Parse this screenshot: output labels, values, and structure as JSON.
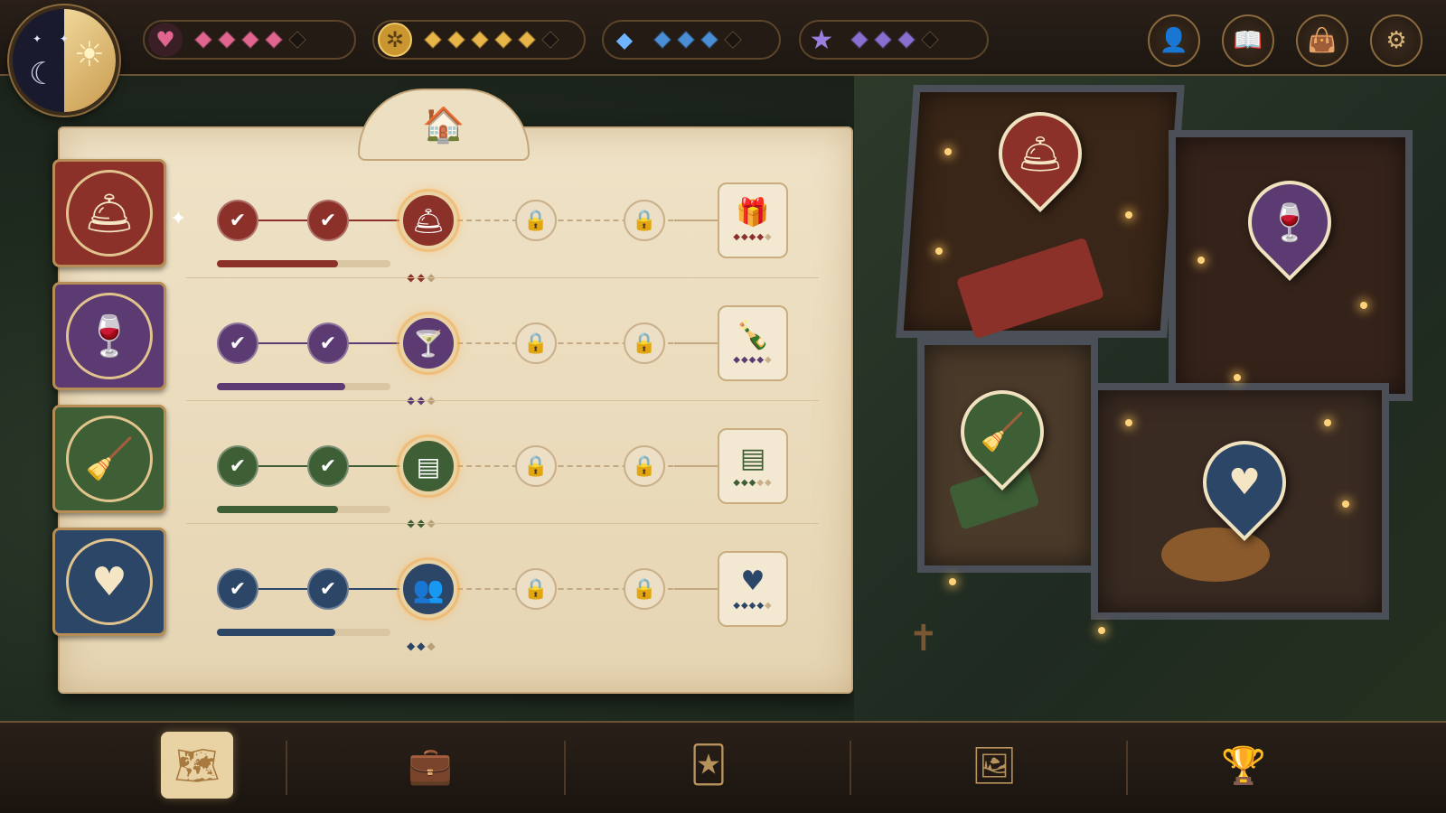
{
  "colors": {
    "hospitality": "#8c3129",
    "bar": "#5c3a72",
    "cleaning": "#3e5f35",
    "care": "#2c4668",
    "heart_pip": "#e0668f",
    "coin_pip": "#e7b548",
    "gem_pip": "#4a8fd6",
    "star_pip": "#8a6fd0"
  },
  "top_bar": {
    "day_night_icon": "sun-moon-icon",
    "stats": [
      {
        "name": "heart",
        "icon": "heart-icon",
        "filled": 4,
        "total": 5
      },
      {
        "name": "coin",
        "icon": "coin-icon",
        "filled": 5,
        "total": 6
      },
      {
        "name": "gem",
        "icon": "gem-icon",
        "filled": 3,
        "total": 4
      },
      {
        "name": "star",
        "icon": "star-icon",
        "filled": 3,
        "total": 4
      }
    ],
    "buttons": [
      "profile-icon",
      "journal-icon",
      "bag-icon",
      "gear-icon"
    ]
  },
  "panel": {
    "header_icon": "manor-icon",
    "tracks": [
      {
        "id": "hospitality",
        "icon": "service-bell-icon",
        "current_icon": "service-bell-icon",
        "completed": 2,
        "locked": 2,
        "reward_icon": "gift-icon",
        "progress": 0.7,
        "gems_filled": 2,
        "gems_total": 3,
        "reward_pips_filled": 4,
        "reward_pips_total": 5
      },
      {
        "id": "bar",
        "icon": "wine-icon",
        "current_icon": "cocktail-icon",
        "completed": 2,
        "locked": 2,
        "reward_icon": "bottle-icon",
        "progress": 0.74,
        "gems_filled": 2,
        "gems_total": 3,
        "reward_pips_filled": 4,
        "reward_pips_total": 5
      },
      {
        "id": "cleaning",
        "icon": "broom-icon",
        "current_icon": "towels-icon",
        "completed": 2,
        "locked": 2,
        "reward_icon": "towels-icon",
        "progress": 0.7,
        "gems_filled": 2,
        "gems_total": 3,
        "reward_pips_filled": 3,
        "reward_pips_total": 5
      },
      {
        "id": "care",
        "icon": "heart-icon",
        "current_icon": "guests-icon",
        "completed": 2,
        "locked": 2,
        "reward_icon": "heart-icon",
        "progress": 0.68,
        "gems_filled": 2,
        "gems_total": 3,
        "reward_pips_filled": 4,
        "reward_pips_total": 5
      }
    ]
  },
  "map": {
    "pins": [
      "service-bell-icon",
      "wine-icon",
      "broom-icon",
      "heart-icon"
    ]
  },
  "bottom_bar": {
    "buttons": [
      "map-icon",
      "medkit-icon",
      "cards-icon",
      "portrait-icon",
      "trophy-icon"
    ],
    "active": 0
  }
}
